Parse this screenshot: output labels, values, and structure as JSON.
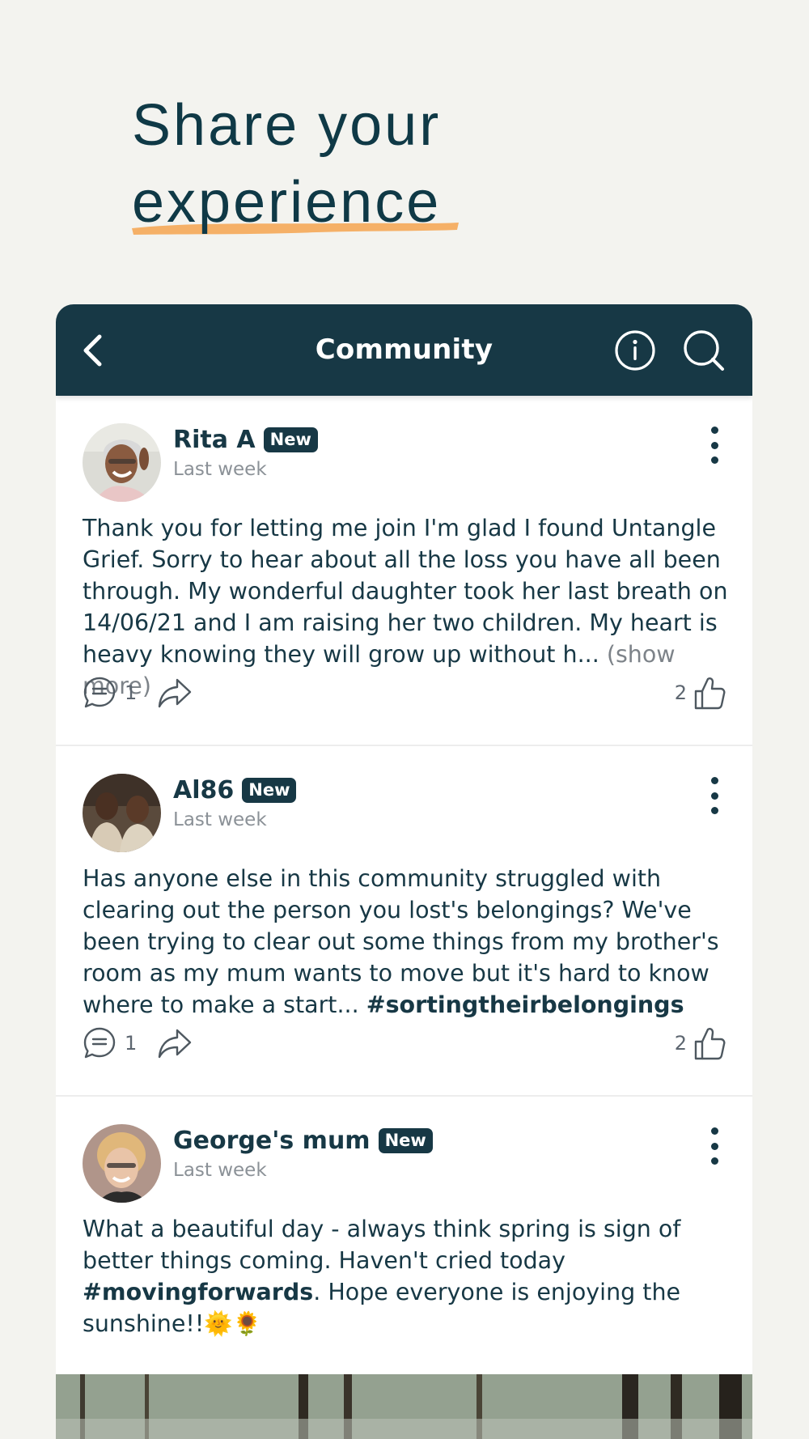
{
  "hero": {
    "line1": "Share your",
    "line2": "experience"
  },
  "topbar": {
    "title": "Community"
  },
  "posts": [
    {
      "author": "Rita A",
      "badge": "New",
      "time": "Last week",
      "body": "Thank you for letting me join I'm glad I found Untangle Grief. Sorry to hear about all the loss you have all been through. My wonderful daughter took her last breath on 14/06/21 and I am raising her two children. My heart is heavy knowing they will grow up without h...",
      "show_more": "(show more)",
      "comments": "1",
      "likes": "2"
    },
    {
      "author": "Al86",
      "badge": "New",
      "time": "Last week",
      "body": "Has anyone else in this community struggled with clearing out the person you lost's belongings? We've been trying to clear out some things from my brother's room as my mum wants to move but it's hard to know where to make a start...",
      "tag": "#sortingtheirbelongings",
      "comments": "1",
      "likes": "2"
    },
    {
      "author": "George's mum",
      "badge": "New",
      "time": "Last week",
      "body_start": "What a beautiful day - always think spring is sign of better things coming. Haven't cried today",
      "tag": "#movingforwards",
      "body_end": ". Hope everyone is enjoying the sunshine!!🌞🌻"
    }
  ],
  "colors": {
    "background": "#f3f3ef",
    "navy": "#173845",
    "accent_underline": "#f5b067"
  }
}
